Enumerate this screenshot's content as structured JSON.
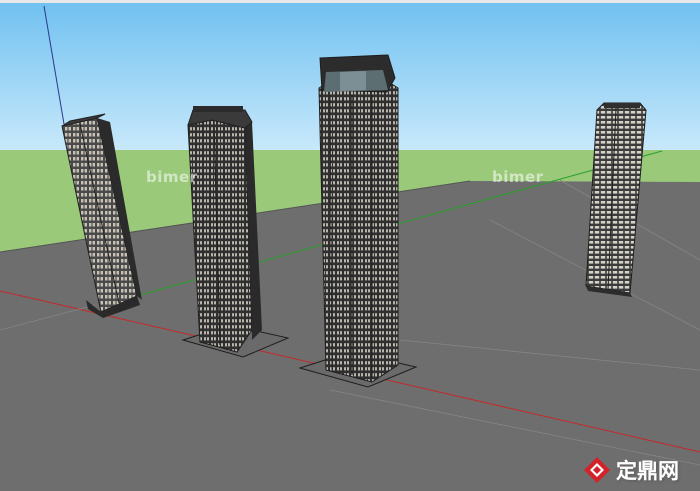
{
  "viewport": {
    "sky_color": "#9fd3f3",
    "grass_color": "#9ac97a",
    "ground_color": "#6c6c6c"
  },
  "watermark": {
    "text": "bimer"
  },
  "brand": {
    "name": "定鼎网",
    "icon": "diamond-logo-icon",
    "accent": "#d2232a"
  },
  "axes": {
    "red_axis": "#cc2222",
    "green_axis": "#22aa22",
    "blue_axis": "#2233aa"
  }
}
